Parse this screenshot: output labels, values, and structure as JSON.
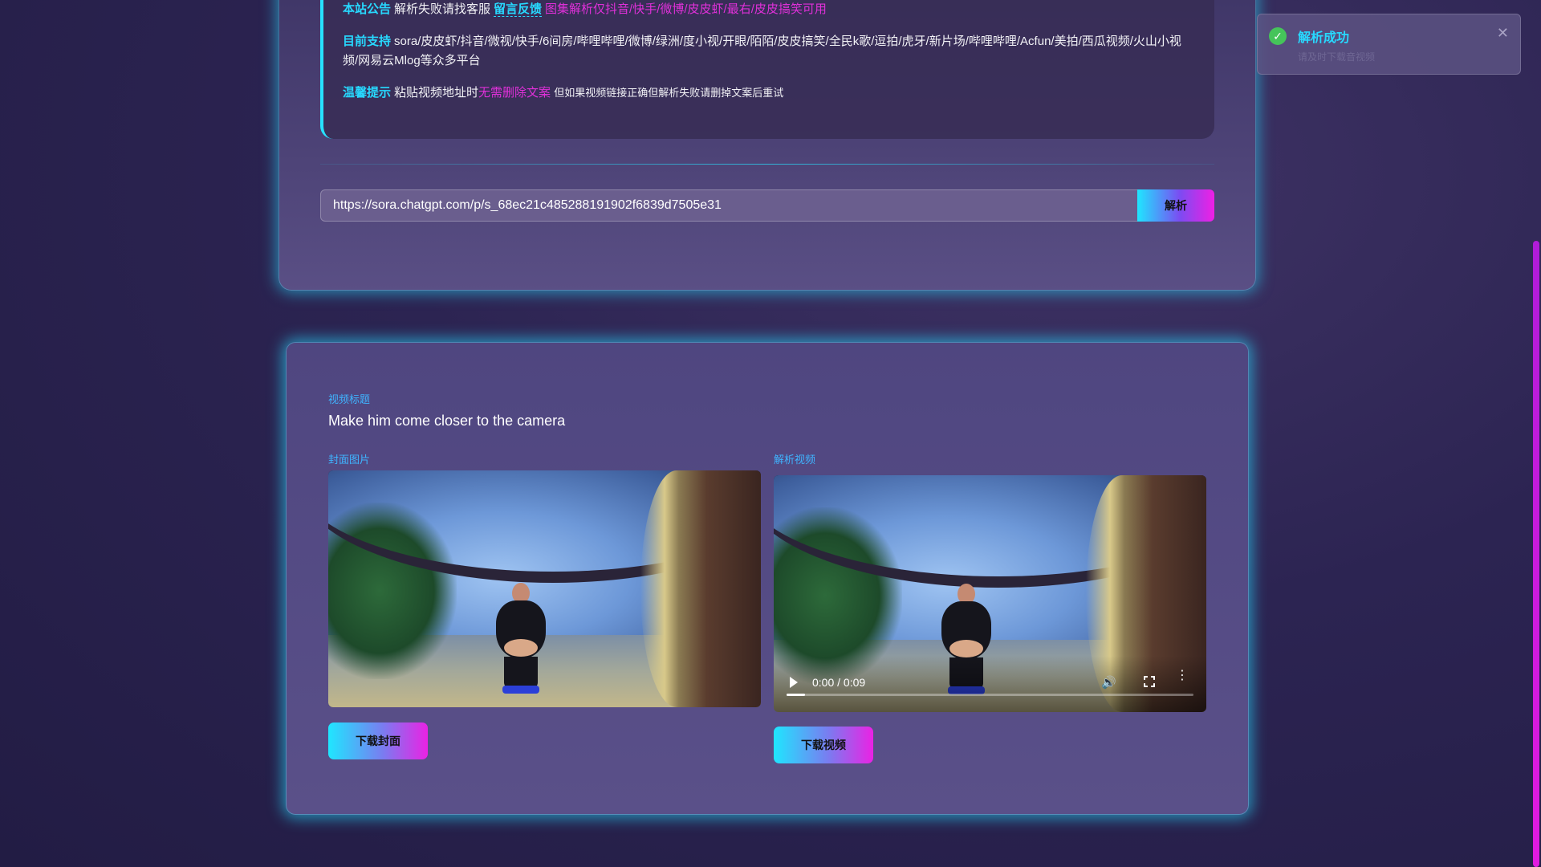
{
  "notice": {
    "line1": {
      "label": "本站公告",
      "text": "解析失败请找客服",
      "link": "留言反馈",
      "pink": "图集解析仅抖音/快手/微博/皮皮虾/最右/皮皮搞笑可用"
    },
    "line2": {
      "label": "目前支持",
      "text": "sora/皮皮虾/抖音/微视/快手/6间房/哔哩哔哩/微博/绿洲/度小视/开眼/陌陌/皮皮搞笑/全民k歌/逗拍/虎牙/新片场/哔哩哔哩/Acfun/美拍/西瓜视频/火山小视频/网易云Mlog等众多平台"
    },
    "line3": {
      "label": "温馨提示",
      "text": "粘贴视频地址时",
      "pink": "无需删除文案",
      "small": "但如果视频链接正确但解析失败请删掉文案后重试"
    }
  },
  "search": {
    "value": "https://sora.chatgpt.com/p/s_68ec21c485288191902f6839d7505e31",
    "button": "解析"
  },
  "result": {
    "title_label": "视频标题",
    "title": "Make him come closer to the camera",
    "cover_label": "封面图片",
    "video_label": "解析视频",
    "video_time": "0:00 / 0:09",
    "download_cover": "下载封面",
    "download_video": "下载视频"
  },
  "toast": {
    "title": "解析成功",
    "subtitle": "请及时下载音视频"
  },
  "colors": {
    "accent_cyan": "#27d9ff",
    "accent_pink": "#e030d9",
    "success": "#45c45a"
  },
  "icons": [
    "check-circle-icon",
    "close-icon",
    "play-icon",
    "volume-icon",
    "fullscreen-icon",
    "more-vert-icon"
  ]
}
